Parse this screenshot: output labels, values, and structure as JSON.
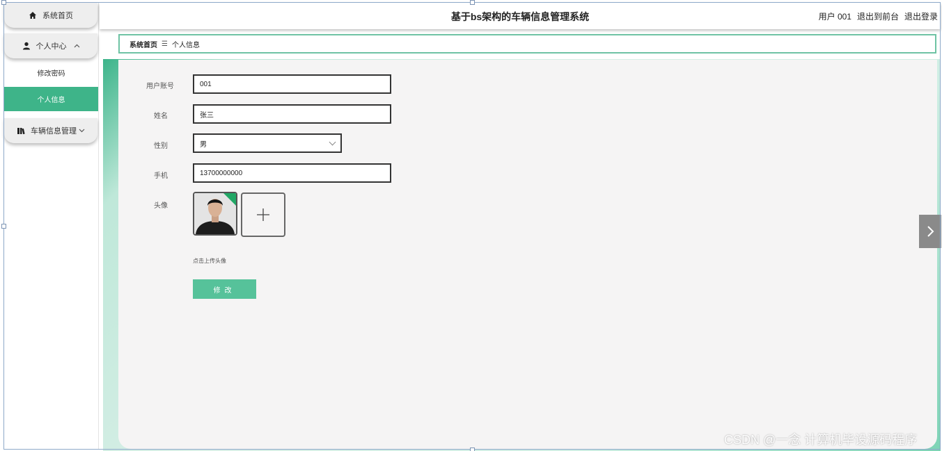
{
  "sidebar": {
    "home": "系统首页",
    "personal_center": "个人中心",
    "change_password": "修改密码",
    "personal_info": "个人信息",
    "vehicle_mgmt": "车辆信息管理"
  },
  "header": {
    "title": "基于bs架构的车辆信息管理系统",
    "user": "用户 001",
    "exit_front": "退出到前台",
    "logout": "退出登录"
  },
  "breadcrumb": {
    "home": "系统首页",
    "separator": "☰",
    "current": "个人信息"
  },
  "form": {
    "account_label": "用户账号",
    "account_value": "001",
    "name_label": "姓名",
    "name_value": "张三",
    "gender_label": "性别",
    "gender_value": "男",
    "phone_label": "手机",
    "phone_value": "13700000000",
    "avatar_label": "头像",
    "upload_hint": "点击上传头像",
    "submit_label": "修改"
  },
  "watermark": "CSDN @一念 计算机毕设源码程序",
  "colors": {
    "accent": "#3eb489",
    "button": "#56c29a"
  }
}
